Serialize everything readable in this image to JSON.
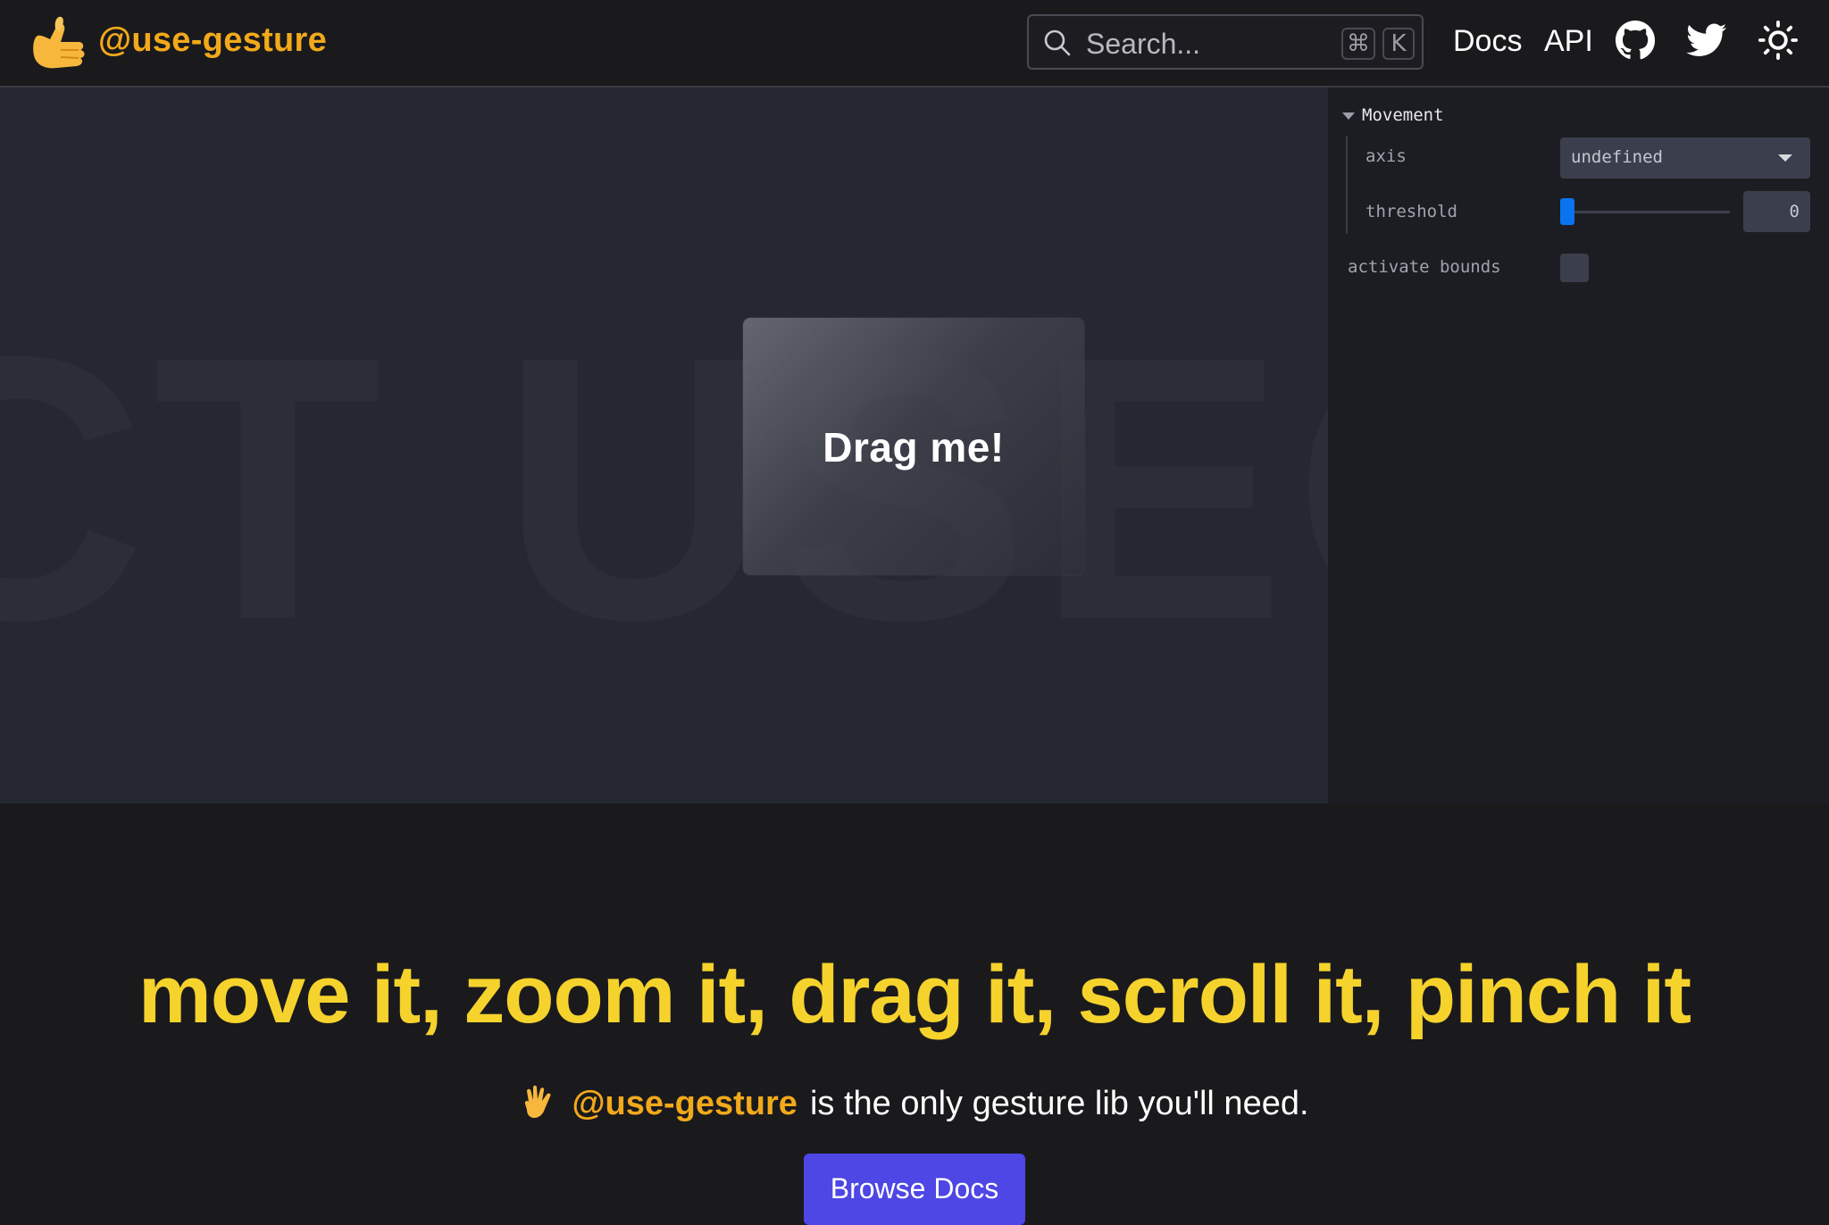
{
  "header": {
    "brand": "@use-gesture",
    "logo_icon": "call-me-hand-emoji",
    "search": {
      "placeholder": "Search...",
      "shortcut_modifier": "⌘",
      "shortcut_key": "K"
    },
    "nav": {
      "docs": "Docs",
      "api": "API"
    },
    "icons": [
      "github-icon",
      "twitter-icon",
      "theme-toggle-sun-icon"
    ]
  },
  "demo": {
    "background_text": "CT USEG",
    "card_label": "Drag me!"
  },
  "controls": {
    "folder_title": "Movement",
    "axis": {
      "label": "axis",
      "value": "undefined"
    },
    "threshold": {
      "label": "threshold",
      "value": "0",
      "slider_fraction": 0
    },
    "bounds": {
      "label": "activate bounds",
      "checked": false
    }
  },
  "hero": {
    "headline": "move it, zoom it, drag it, scroll it, pinch it",
    "tagline_brand": "@use-gesture",
    "tagline_rest": "is the only gesture lib you'll need.",
    "cta": "Browse Docs"
  },
  "colors": {
    "brand_orange": "#f2a91a",
    "headline_yellow": "#f6d22d",
    "cta_purple": "#4e46e5",
    "slider_blue": "#0a74f0"
  }
}
